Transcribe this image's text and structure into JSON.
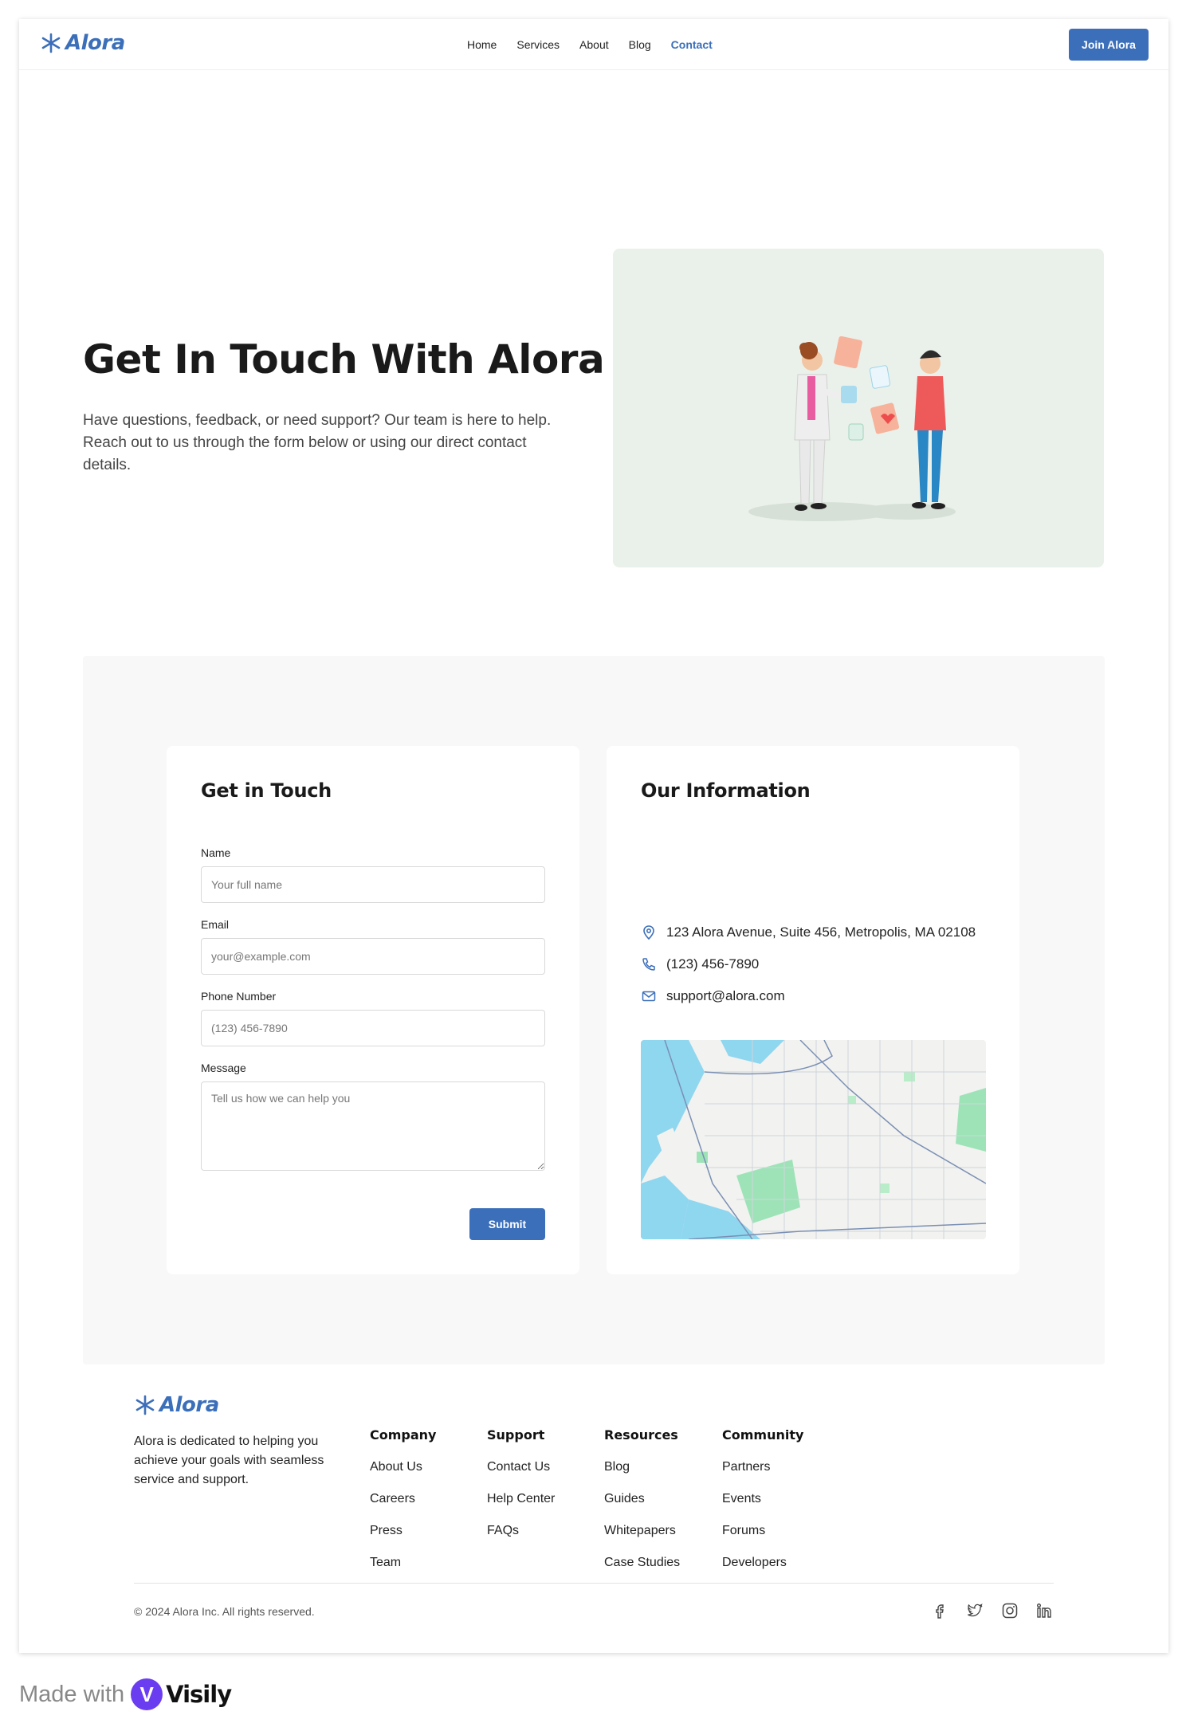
{
  "brand": {
    "name": "Alora",
    "color": "#3c6fba"
  },
  "nav": {
    "items": [
      "Home",
      "Services",
      "About",
      "Blog",
      "Contact"
    ],
    "active": "Contact",
    "cta": "Join Alora"
  },
  "hero": {
    "title": "Get In Touch With Alora",
    "description": "Have questions, feedback, or need support? Our team is here to help. Reach out to us through the form below or using our direct contact details."
  },
  "form": {
    "title": "Get in Touch",
    "fields": {
      "name": {
        "label": "Name",
        "placeholder": "Your full name"
      },
      "email": {
        "label": "Email",
        "placeholder": "your@example.com"
      },
      "phone": {
        "label": "Phone Number",
        "placeholder": "(123) 456-7890"
      },
      "message": {
        "label": "Message",
        "placeholder": "Tell us how we can help you"
      }
    },
    "submit": "Submit"
  },
  "info": {
    "title": "Our Information",
    "address": "123 Alora Avenue, Suite 456, Metropolis, MA 02108",
    "phone": "(123) 456-7890",
    "email": "support@alora.com"
  },
  "footer": {
    "about": "Alora is dedicated to helping you achieve your goals with seamless service and support.",
    "columns": [
      {
        "title": "Company",
        "links": [
          "About Us",
          "Careers",
          "Press",
          "Team"
        ]
      },
      {
        "title": "Support",
        "links": [
          "Contact Us",
          "Help Center",
          "FAQs"
        ]
      },
      {
        "title": "Resources",
        "links": [
          "Blog",
          "Guides",
          "Whitepapers",
          "Case Studies"
        ]
      },
      {
        "title": "Community",
        "links": [
          "Partners",
          "Events",
          "Forums",
          "Developers"
        ]
      }
    ],
    "copyright": "© 2024 Alora Inc. All rights reserved.",
    "social": [
      "facebook-icon",
      "twitter-icon",
      "instagram-icon",
      "linkedin-icon"
    ]
  },
  "made_with": {
    "prefix": "Made with",
    "brand": "Visily"
  }
}
